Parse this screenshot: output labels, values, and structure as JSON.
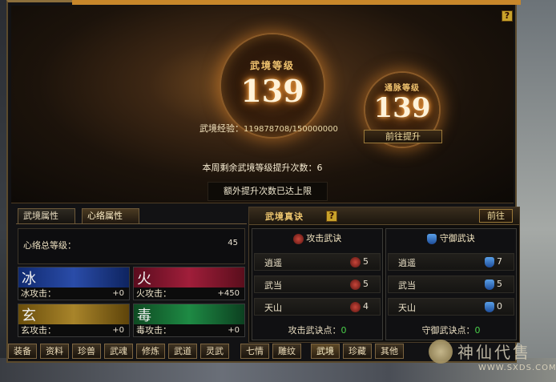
{
  "top": {
    "wujing_level_label": "武境等级",
    "wujing_level": "139",
    "tongmai_level_label": "通脉等级",
    "tongmai_level": "139",
    "exp_label": "武境经验：",
    "exp_value": "119878708/150000000",
    "goto_upgrade": "前往提升",
    "weekly_remaining": "本周剩余武境等级提升次数：6",
    "extra_limit": "额外提升次数已达上限",
    "help": "?"
  },
  "left": {
    "tabs": [
      "武境属性",
      "心络属性"
    ],
    "total_label": "心络总等级：",
    "total_value": "45",
    "elements": [
      {
        "name": "冰",
        "stat": "冰攻击：",
        "value": "+0",
        "color": "#1c3a8a"
      },
      {
        "name": "火",
        "stat": "火攻击：",
        "value": "+450",
        "color": "#8a1830"
      },
      {
        "name": "玄",
        "stat": "玄攻击：",
        "value": "+0",
        "color": "#8a6a14"
      },
      {
        "name": "毒",
        "stat": "毒攻击：",
        "value": "+0",
        "color": "#1a6a34"
      }
    ]
  },
  "right": {
    "title": "武境真诀",
    "help": "?",
    "goto": "前往",
    "attack": {
      "header": "攻击武诀",
      "rows": [
        {
          "name": "逍遥",
          "value": "5"
        },
        {
          "name": "武当",
          "value": "5"
        },
        {
          "name": "天山",
          "value": "4"
        }
      ],
      "points_label": "攻击武诀点：",
      "points": "0"
    },
    "defense": {
      "header": "守御武诀",
      "rows": [
        {
          "name": "逍遥",
          "value": "7"
        },
        {
          "name": "武当",
          "value": "5"
        },
        {
          "name": "天山",
          "value": "0"
        }
      ],
      "points_label": "守御武诀点：",
      "points": "0"
    }
  },
  "bottom_tabs": [
    "装备",
    "资料",
    "珍兽",
    "武魂",
    "修炼",
    "武道",
    "灵武",
    "七情",
    "雕纹",
    "武境",
    "珍藏",
    "其他"
  ],
  "active_bottom_tab": "武境",
  "watermark": {
    "brand": "神仙代售",
    "url": "WWW.SXDS.COM"
  }
}
